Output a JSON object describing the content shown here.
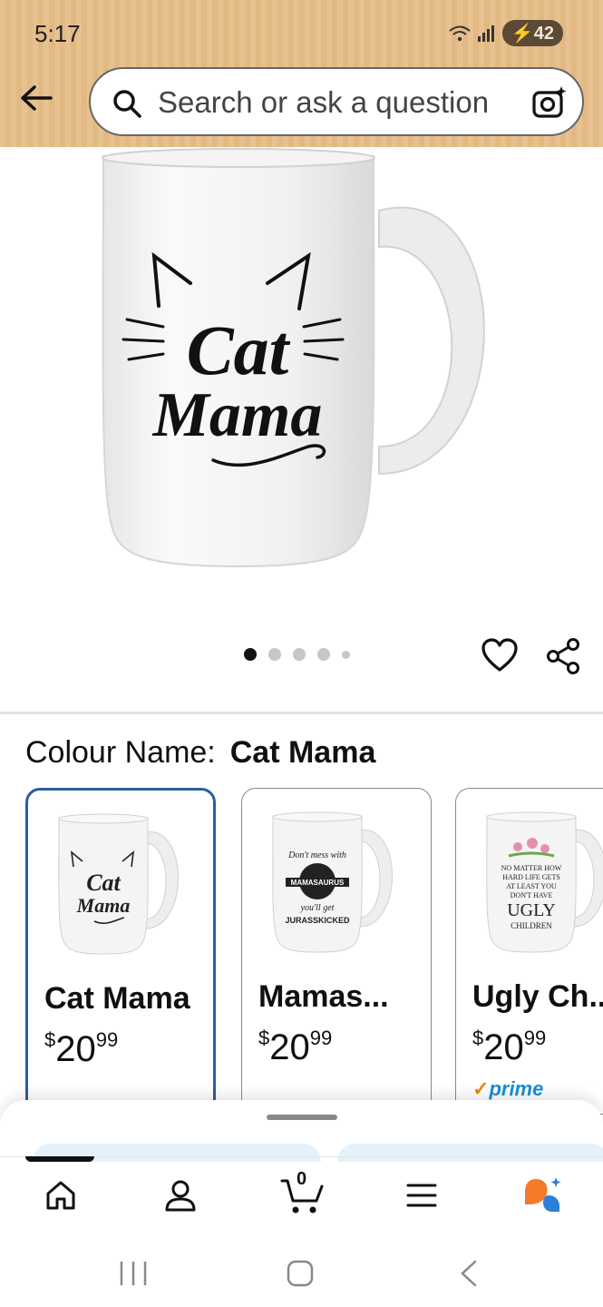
{
  "status_bar": {
    "time": "5:17",
    "battery": "42"
  },
  "header": {
    "search_placeholder": "Search or ask a question"
  },
  "product": {
    "mug_text_line1": "Cat",
    "mug_text_line2": "Mama",
    "carousel": {
      "total_images": 5,
      "active_index": 0
    }
  },
  "variations": {
    "label": "Colour Name:",
    "selected_value": "Cat Mama",
    "options": [
      {
        "name": "Cat Mama",
        "price_symbol": "$",
        "price_whole": "20",
        "price_cents": "99",
        "selected": true
      },
      {
        "name": "Mamas...",
        "price_symbol": "$",
        "price_whole": "20",
        "price_cents": "99",
        "selected": false
      },
      {
        "name": "Ugly Ch...",
        "price_symbol": "$",
        "price_whole": "20",
        "price_cents": "99",
        "selected": false,
        "prime": "prime"
      }
    ]
  },
  "bottom_nav": {
    "cart_count": "0",
    "active_tab": "home"
  },
  "colors": {
    "header_bg": "#e7c18f",
    "selected_border": "#2d5f9e",
    "prime_blue": "#1a8fd6",
    "prime_check": "#f08804",
    "rufus_orange": "#f47a2a",
    "rufus_blue": "#2b7fd9"
  }
}
